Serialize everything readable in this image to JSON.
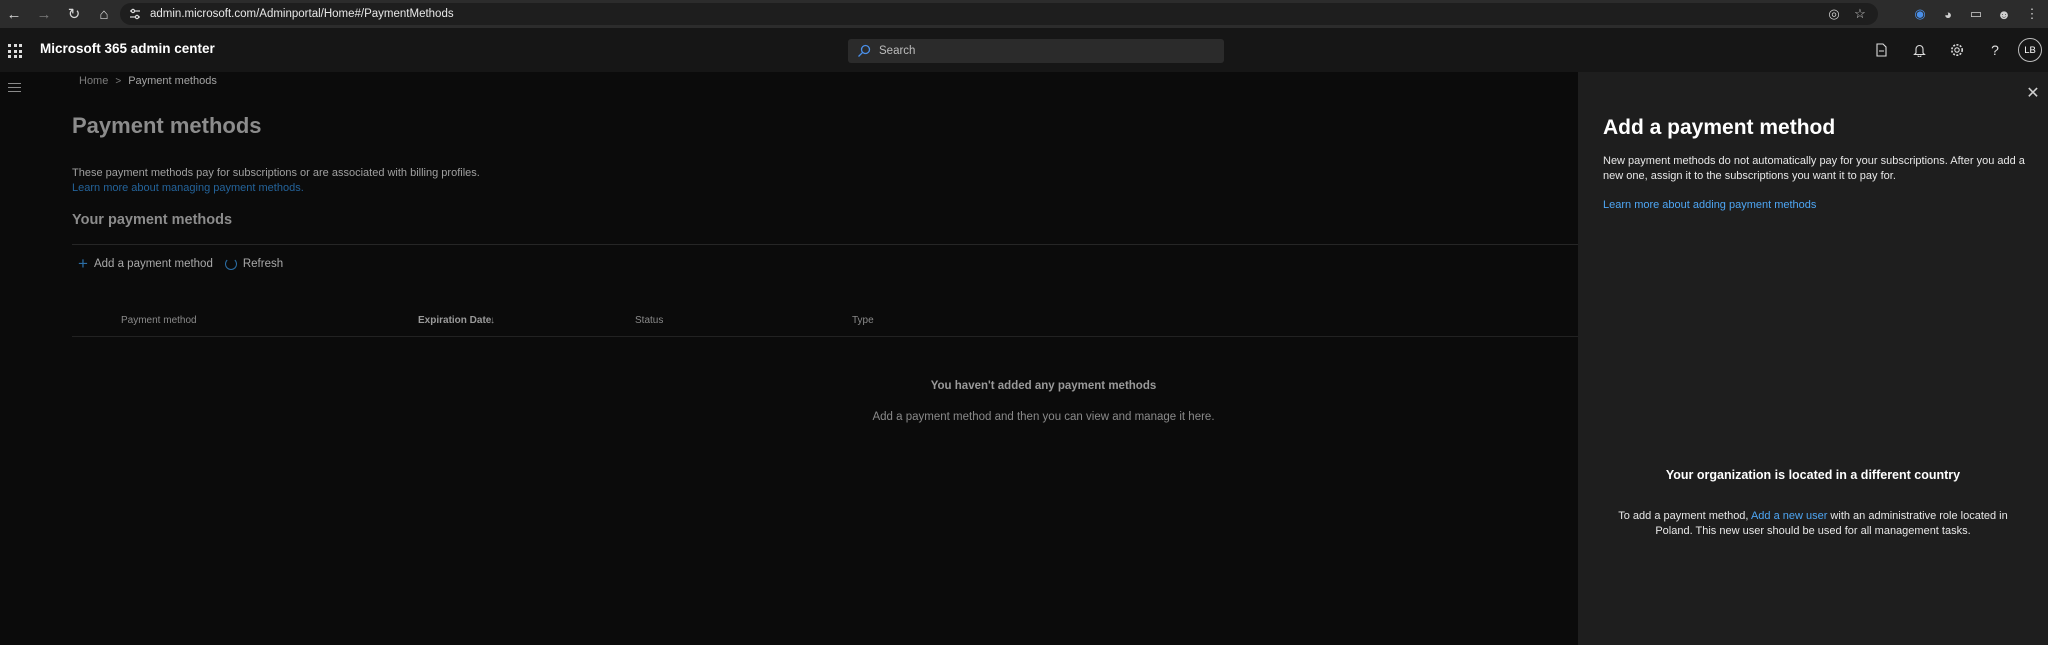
{
  "browser": {
    "url": "admin.microsoft.com/Adminportal/Home#/PaymentMethods"
  },
  "header": {
    "app_title": "Microsoft 365 admin center",
    "search_placeholder": "Search",
    "avatar_initials": "LB"
  },
  "breadcrumb": {
    "home": "Home",
    "separator": ">",
    "current": "Payment methods"
  },
  "main": {
    "page_title": "Payment methods",
    "description": "These payment methods pay for subscriptions or are associated with billing profiles.",
    "learn_more": "Learn more about managing payment methods.",
    "section_title": "Your payment methods",
    "toolbar": {
      "add_label": "Add a payment method",
      "refresh_label": "Refresh"
    },
    "columns": [
      "Payment method",
      "Expiration Date",
      "Status",
      "Type"
    ],
    "sort_indicator": "↓",
    "empty_title": "You haven't added any payment methods",
    "empty_subtitle": "Add a payment method and then you can view and manage it here."
  },
  "panel": {
    "title": "Add a payment method",
    "description": "New payment methods do not automatically pay for your subscriptions. After you add a new one, assign it to the subscriptions you want it to pay for.",
    "learn_more": "Learn more about adding payment methods",
    "org_title": "Your organization is located in a different country",
    "org_desc_prefix": "To add a payment method, ",
    "org_desc_link": "Add a new user",
    "org_desc_suffix": " with an administrative role located in Poland. This new user should be used for all management tasks."
  },
  "colors": {
    "accent": "#4ea6f4",
    "panel_bg": "#1e1e1e",
    "page_bg": "#0b0b0b"
  }
}
